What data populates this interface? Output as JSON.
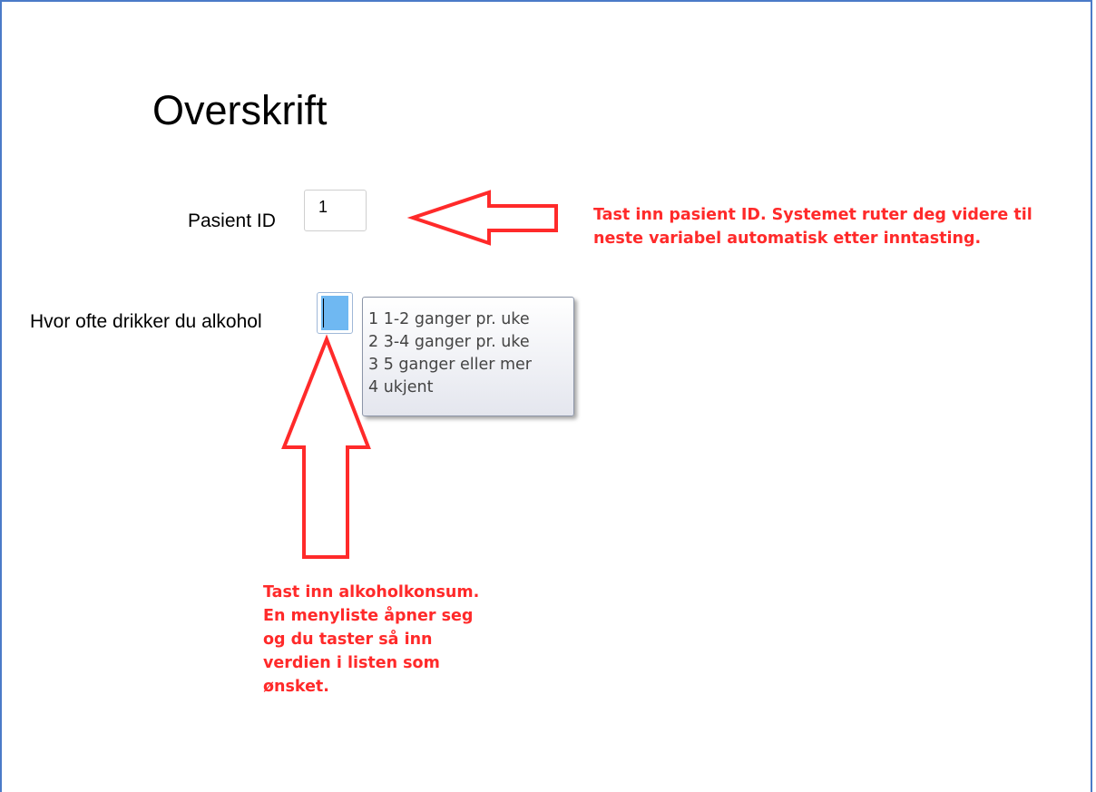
{
  "form": {
    "heading": "Overskrift",
    "patient_id": {
      "label": "Pasient ID",
      "value": "1"
    },
    "alcohol": {
      "label": "Hvor ofte drikker du alkohol",
      "value": "",
      "options": [
        "1 1-2 ganger pr. uke",
        "2 3-4 ganger pr. uke",
        "3 5 ganger eller mer",
        "4 ukjent"
      ]
    }
  },
  "annotations": {
    "patient_id_note": "Tast inn pasient ID. Systemet ruter deg videre til\nneste variabel automatisk etter inntasting.",
    "alcohol_note": "Tast inn alkoholkonsum.\nEn menyliste åpner seg\nog du taster så inn\nverdien i listen som\nønsket.",
    "color": "#ff2a2a"
  },
  "colors": {
    "frame_border": "#4a7bc8",
    "selection": "#6fb8f2"
  }
}
